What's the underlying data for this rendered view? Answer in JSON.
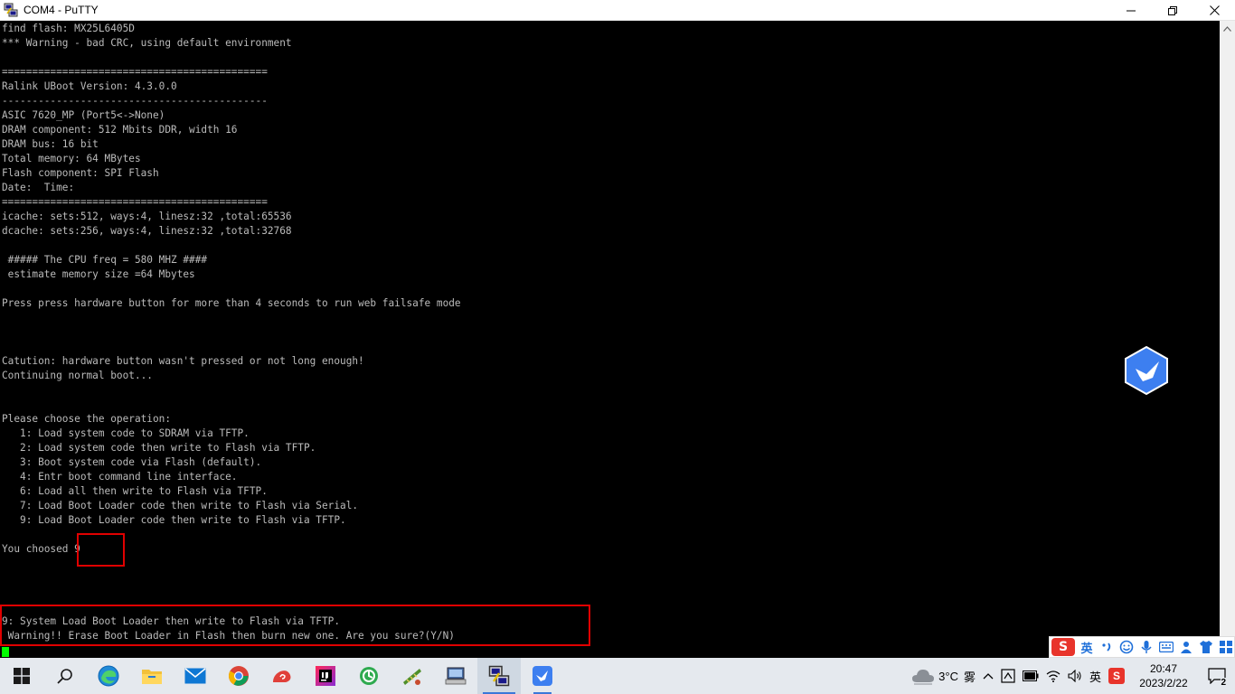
{
  "window": {
    "title": "COM4 - PuTTY",
    "minimize_label": "minimize",
    "maximize_label": "maximize",
    "close_label": "close"
  },
  "terminal": {
    "lines": [
      "find flash: MX25L6405D",
      "*** Warning - bad CRC, using default environment",
      "",
      "============================================",
      "Ralink UBoot Version: 4.3.0.0",
      "--------------------------------------------",
      "ASIC 7620_MP (Port5<->None)",
      "DRAM component: 512 Mbits DDR, width 16",
      "DRAM bus: 16 bit",
      "Total memory: 64 MBytes",
      "Flash component: SPI Flash",
      "Date:  Time:",
      "============================================",
      "icache: sets:512, ways:4, linesz:32 ,total:65536",
      "dcache: sets:256, ways:4, linesz:32 ,total:32768",
      "",
      " ##### The CPU freq = 580 MHZ ####",
      " estimate memory size =64 Mbytes",
      "",
      "Press press hardware button for more than 4 seconds to run web failsafe mode",
      "",
      "",
      "",
      "Catution: hardware button wasn't pressed or not long enough!",
      "Continuing normal boot...",
      "",
      "",
      "Please choose the operation:",
      "   1: Load system code to SDRAM via TFTP.",
      "   2: Load system code then write to Flash via TFTP.",
      "   3: Boot system code via Flash (default).",
      "   4: Entr boot command line interface.",
      "   6: Load all then write to Flash via TFTP.",
      "   7: Load Boot Loader code then write to Flash via Serial.",
      "   9: Load Boot Loader code then write to Flash via TFTP.",
      "",
      "You choosed 9",
      "",
      "",
      "",
      "",
      "9: System Load Boot Loader then write to Flash via TFTP.",
      " Warning!! Erase Boot Loader in Flash then burn new one. Are you sure?(Y/N)"
    ]
  },
  "ime": {
    "logo": "S",
    "lang": "英",
    "punct": "')",
    "icons": [
      "emoji-icon",
      "mic-icon",
      "keyboard-icon",
      "skin-icon",
      "shirt-icon",
      "grid-icon"
    ]
  },
  "taskbar": {
    "apps": [
      "start",
      "search",
      "edge",
      "file-explorer",
      "mail",
      "chrome",
      "app-snail",
      "intellij",
      "app-green",
      "app-pcb",
      "app-network",
      "putty",
      "app-bird"
    ],
    "weather_temp": "3°C",
    "weather_desc": "雾",
    "ime_lang": "英",
    "time": "20:47",
    "date": "2023/2/22",
    "notification_count": "2"
  },
  "colors": {
    "terminal_bg": "#000000",
    "terminal_fg": "#bbbbbb",
    "cursor": "#00ff00",
    "highlight": "#e00000",
    "taskbar_bg": "#e5e9ee"
  }
}
